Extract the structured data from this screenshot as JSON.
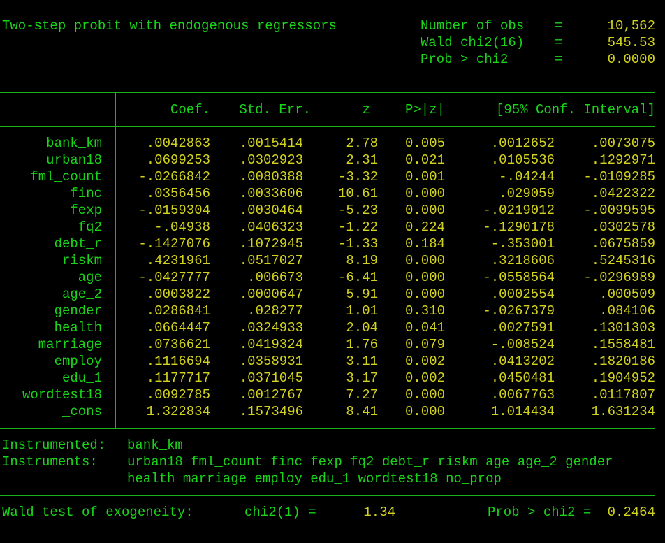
{
  "title": "Two-step probit with endogenous regressors",
  "summary": [
    {
      "label": "Number of obs",
      "eq": "=",
      "value": "10,562"
    },
    {
      "label": "Wald chi2(16)",
      "eq": "=",
      "value": "545.53"
    },
    {
      "label": "Prob > chi2",
      "eq": "=",
      "value": "0.0000"
    }
  ],
  "table": {
    "headers": [
      "Coef.",
      "Std. Err.",
      "z",
      "P>|z|",
      "[95% Conf. Interval]"
    ],
    "rows": [
      {
        "var": "bank_km",
        "coef": ".0042863",
        "se": ".0015414",
        "z": "2.78",
        "p": "0.005",
        "lo": ".0012652",
        "hi": ".0073075"
      },
      {
        "var": "urban18",
        "coef": ".0699253",
        "se": ".0302923",
        "z": "2.31",
        "p": "0.021",
        "lo": ".0105536",
        "hi": ".1292971"
      },
      {
        "var": "fml_count",
        "coef": "-.0266842",
        "se": ".0080388",
        "z": "-3.32",
        "p": "0.001",
        "lo": "-.04244",
        "hi": "-.0109285"
      },
      {
        "var": "finc",
        "coef": ".0356456",
        "se": ".0033606",
        "z": "10.61",
        "p": "0.000",
        "lo": ".029059",
        "hi": ".0422322"
      },
      {
        "var": "fexp",
        "coef": "-.0159304",
        "se": ".0030464",
        "z": "-5.23",
        "p": "0.000",
        "lo": "-.0219012",
        "hi": "-.0099595"
      },
      {
        "var": "fq2",
        "coef": "-.04938",
        "se": ".0406323",
        "z": "-1.22",
        "p": "0.224",
        "lo": "-.1290178",
        "hi": ".0302578"
      },
      {
        "var": "debt_r",
        "coef": "-.1427076",
        "se": ".1072945",
        "z": "-1.33",
        "p": "0.184",
        "lo": "-.353001",
        "hi": ".0675859"
      },
      {
        "var": "riskm",
        "coef": ".4231961",
        "se": ".0517027",
        "z": "8.19",
        "p": "0.000",
        "lo": ".3218606",
        "hi": ".5245316"
      },
      {
        "var": "age",
        "coef": "-.0427777",
        "se": ".006673",
        "z": "-6.41",
        "p": "0.000",
        "lo": "-.0558564",
        "hi": "-.0296989"
      },
      {
        "var": "age_2",
        "coef": ".0003822",
        "se": ".0000647",
        "z": "5.91",
        "p": "0.000",
        "lo": ".0002554",
        "hi": ".000509"
      },
      {
        "var": "gender",
        "coef": ".0286841",
        "se": ".028277",
        "z": "1.01",
        "p": "0.310",
        "lo": "-.0267379",
        "hi": ".084106"
      },
      {
        "var": "health",
        "coef": ".0664447",
        "se": ".0324933",
        "z": "2.04",
        "p": "0.041",
        "lo": ".0027591",
        "hi": ".1301303"
      },
      {
        "var": "marriage",
        "coef": ".0736621",
        "se": ".0419324",
        "z": "1.76",
        "p": "0.079",
        "lo": "-.008524",
        "hi": ".1558481"
      },
      {
        "var": "employ",
        "coef": ".1116694",
        "se": ".0358931",
        "z": "3.11",
        "p": "0.002",
        "lo": ".0413202",
        "hi": ".1820186"
      },
      {
        "var": "edu_1",
        "coef": ".1177717",
        "se": ".0371045",
        "z": "3.17",
        "p": "0.002",
        "lo": ".0450481",
        "hi": ".1904952"
      },
      {
        "var": "wordtest18",
        "coef": ".0092785",
        "se": ".0012767",
        "z": "7.27",
        "p": "0.000",
        "lo": ".0067763",
        "hi": ".0117807"
      },
      {
        "var": "_cons",
        "coef": "1.322834",
        "se": ".1573496",
        "z": "8.41",
        "p": "0.000",
        "lo": "1.014434",
        "hi": "1.631234"
      }
    ]
  },
  "instrumented": {
    "label": "Instrumented:",
    "value": "bank_km"
  },
  "instruments": {
    "label": "Instruments:",
    "line1": "urban18 fml_count finc fexp fq2 debt_r riskm age age_2 gender",
    "line2": "health marriage employ edu_1 wordtest18 no_prop"
  },
  "exogeneity": {
    "label": "Wald test of exogeneity:",
    "stat_label": "chi2(1) =",
    "stat_value": "1.34",
    "prob_label": "Prob > chi2 =",
    "prob_value": "0.2464"
  },
  "colors": {
    "text_green": "#19d419",
    "value_yellow": "#d2d21e",
    "background": "#000000"
  }
}
